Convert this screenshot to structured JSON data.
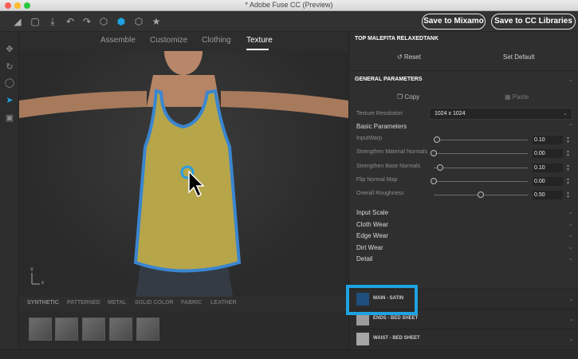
{
  "window": {
    "title": "* Adobe Fuse CC (Preview)"
  },
  "colors": {
    "accent": "#1ea2e0",
    "tank_fill": "#b7a54a",
    "tank_outline": "#3a86d0"
  },
  "toolbar": {
    "icons": [
      "logo-icon",
      "open-icon",
      "export-icon",
      "undo-icon",
      "redo-icon",
      "cube-outline-icon",
      "cube-solid-icon",
      "cube-icon",
      "star-icon"
    ],
    "save_mixamo": "Save to Mixamo",
    "save_cc": "Save to CC Libraries"
  },
  "left_tools": [
    "move-icon",
    "orbit-icon",
    "rotate-icon",
    "select-pointer-icon",
    "camera-icon"
  ],
  "tabs": [
    "Assemble",
    "Customize",
    "Clothing",
    "Texture"
  ],
  "active_tab": "Texture",
  "axis": {
    "y": "Y",
    "x": "x"
  },
  "material_tabs": [
    "SYNTHETIC",
    "PATTERNED",
    "METAL",
    "SOLID COLOR",
    "FABRIC",
    "LEATHER"
  ],
  "active_material_tab": "SYNTHETIC",
  "panel": {
    "title": "TOP MALEFITA RELAXEDTANK",
    "reset": "Reset",
    "set_default": "Set Default",
    "general_parameters": "GENERAL PARAMETERS",
    "copy": "Copy",
    "paste": "Paste",
    "texture_resolution_label": "Texture Resolution",
    "texture_resolution_value": "1024 x 1024",
    "basic_parameters": "Basic Parameters",
    "params": [
      {
        "label": "InputWarp",
        "value": "0.10",
        "level": 0.03
      },
      {
        "label": "Strengthen Material Normals",
        "value": "0.00",
        "level": 0.0
      },
      {
        "label": "Strengthen Base Normals",
        "value": "0.10",
        "level": 0.07
      },
      {
        "label": "Flip Normal Map",
        "value": "0.00",
        "level": 0.0
      },
      {
        "label": "Overall Roughness",
        "value": "0.50",
        "level": 0.5
      }
    ],
    "groups": [
      "Input Scale",
      "Cloth Wear",
      "Edge Wear",
      "Dirt Wear",
      "Detail"
    ]
  },
  "materials": [
    {
      "name": "MAIN - SATIN",
      "color": "#1f4f7d"
    },
    {
      "name": "ENDS - BED SHEET",
      "color": "#9c9c9c"
    },
    {
      "name": "WAIST - BED SHEET",
      "color": "#a6a6a6"
    }
  ]
}
